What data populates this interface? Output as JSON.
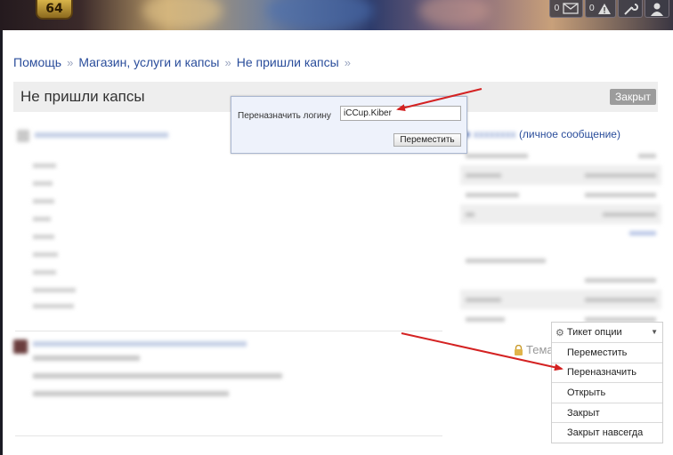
{
  "banner": {
    "level": "64"
  },
  "topnav": {
    "messages_count": "0",
    "alerts_count": "0"
  },
  "breadcrumb": {
    "items": [
      "Помощь",
      "Магазин, услуги и капсы",
      "Не пришли капсы"
    ],
    "separator": "»"
  },
  "title_bar": {
    "title": "Не пришли капсы",
    "status": "Закрыт"
  },
  "popup": {
    "label": "Переназначить логину",
    "input_value": "iCCup.Kiber",
    "button": "Переместить"
  },
  "author": {
    "private_message": "(личное сообщение)"
  },
  "thema": {
    "label": "Тема"
  },
  "ticket_menu": {
    "header": "Тикет опции",
    "items": [
      "Переместить",
      "Переназначить",
      "Открыть",
      "Закрыт",
      "Закрыт навсегда"
    ]
  },
  "colors": {
    "link": "#2a4d9b",
    "arrow": "#d42222",
    "badge": "#9c9c9c"
  }
}
